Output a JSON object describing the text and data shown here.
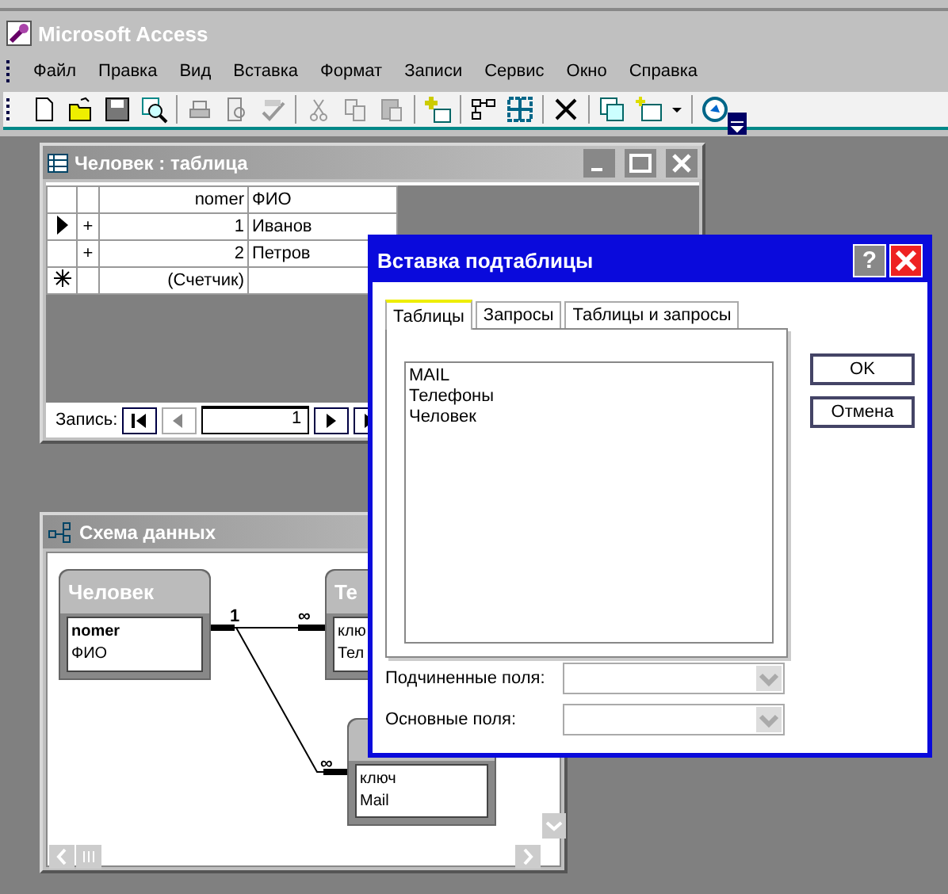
{
  "app": {
    "title": "Microsoft Access"
  },
  "menu": [
    "Файл",
    "Правка",
    "Вид",
    "Вставка",
    "Формат",
    "Записи",
    "Сервис",
    "Окно",
    "Справка"
  ],
  "table_window": {
    "title": "Человек : таблица",
    "columns": [
      "nomer",
      "ФИО"
    ],
    "rows": [
      {
        "kind": "record",
        "current": true,
        "expand": "+",
        "nomer": "1",
        "fio": "Иванов"
      },
      {
        "kind": "record",
        "current": false,
        "expand": "+",
        "nomer": "2",
        "fio": "Петров"
      },
      {
        "kind": "new",
        "current": false,
        "nomer": "(Счетчик)"
      }
    ],
    "navigator": {
      "label": "Запись:",
      "record": "1"
    }
  },
  "schema_window": {
    "title": "Схема данных",
    "tables": [
      {
        "title": "Человек",
        "fields": [
          {
            "name": "nomer",
            "key": true
          },
          {
            "name": "ФИО",
            "key": false
          }
        ]
      },
      {
        "title": "Те",
        "fields": [
          {
            "name": "клю",
            "key": false
          },
          {
            "name": "Тел",
            "key": false
          }
        ]
      },
      {
        "fields": [
          {
            "name": "ключ",
            "key": false
          },
          {
            "name": "Mail",
            "key": false
          }
        ]
      }
    ],
    "relations": [
      {
        "one": "1",
        "many": "∞"
      },
      {
        "many": "∞"
      }
    ]
  },
  "dialog": {
    "title": "Вставка подтаблицы",
    "help": "?",
    "tabs": [
      {
        "label": "Таблицы",
        "selected": true
      },
      {
        "label": "Запросы",
        "selected": false
      },
      {
        "label": "Таблицы и запросы",
        "selected": false
      }
    ],
    "list": [
      "MAIL",
      "Телефоны",
      "Человек"
    ],
    "buttons": [
      "OK",
      "Отмена"
    ],
    "fields": [
      {
        "label": "Подчиненные поля:"
      },
      {
        "label": "Основные поля:"
      }
    ]
  }
}
